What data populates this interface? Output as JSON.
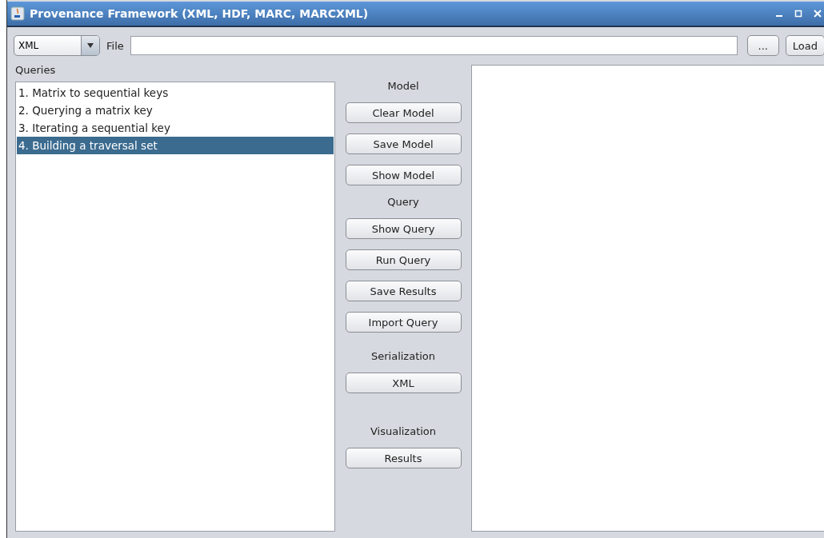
{
  "window": {
    "title": "Provenance Framework (XML, HDF, MARC, MARCXML)"
  },
  "toolbar": {
    "format": "XML",
    "file_label": "File",
    "browse_button": "...",
    "load_button": "Load"
  },
  "queries": {
    "label": "Queries",
    "items": [
      {
        "label": "1. Matrix to sequential keys",
        "selected": false
      },
      {
        "label": "2. Querying a matrix key",
        "selected": false
      },
      {
        "label": "3. Iterating a sequential key",
        "selected": false
      },
      {
        "label": "4. Building a traversal set",
        "selected": true
      }
    ]
  },
  "sections": [
    {
      "heading": "Model",
      "buttons": [
        "Clear Model",
        "Save Model",
        "Show Model"
      ]
    },
    {
      "heading": "Query",
      "buttons": [
        "Show Query",
        "Run Query",
        "Save Results",
        "Import Query"
      ]
    },
    {
      "heading": "Serialization",
      "buttons": [
        "XML"
      ]
    },
    {
      "heading": "Visualization",
      "buttons": [
        "Results"
      ]
    }
  ]
}
